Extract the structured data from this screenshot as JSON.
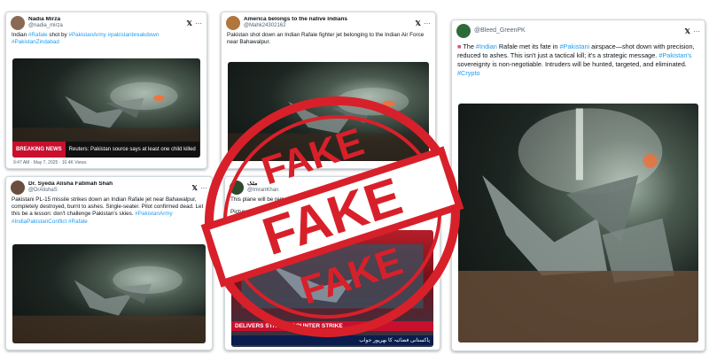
{
  "colors": {
    "accent": "#1d9bf0",
    "stamp": "#d8202a",
    "breaking": "#c8102e",
    "urdu_bar": "#0a1d4d"
  },
  "tweets": [
    {
      "display_name": "Nadia Mirza",
      "handle": "@nadia_mirza",
      "text_prefix": "Indian ",
      "tag1": "#Rafale",
      "text_mid": " shot by ",
      "tag2": "#PakistanArmy #pakistanbreakdown #PakistanZindabad",
      "breaking_label": "BREAKING NEWS",
      "ticker": "Reuters: Pakistan source says at least one child killed",
      "footer": "9:47 AM · May 7, 2025 · 10.4K Views"
    },
    {
      "display_name": "America belongs to the native Indians",
      "handle": "@Mahk24302162",
      "text": "Pakistan shot down an Indian Rafale fighter jet belonging to the Indian Air Force near Bahawalpur."
    },
    {
      "display_name": "Dr. Syeda Alisha Fatimah Shah",
      "handle": "@DrAlishaS",
      "text": "Pakistani PL-15 missile strikes down an Indian Rafale jet near Bahawalpur, completely destroyed, burnt to ashes. Single-seater. Pilot confirmed dead. Let this be a lesson: don't challenge Pakistan's skies.",
      "tags": "#PakistanArmy #IndiaPakistanConflict #Rafale"
    },
    {
      "display_name": "ملک",
      "handle": "@ImranKhan",
      "text_line1": "This plane will be remembered for years",
      "text_line2": "Picture of the Indian Rafale",
      "red_bar": "DELIVERS STRONG COUNTER STRIKE",
      "urdu_text": "پاکستانی فضائیہ کا بھرپور جواب"
    },
    {
      "handle": "@Bleed_GreenPK",
      "text_a": " The ",
      "tag_indian": "#Indian",
      "text_b": " Rafale met its fate in ",
      "tag_pak": "#Pakistani",
      "text_c": " airspace—shot down with precision, reduced to ashes. This isn't just a tactical kill; it's a strategic message. ",
      "tag_pak2": "#Pakistan's",
      "text_d": " sovereignty is non-negotiable. Intruders will be hunted, targeted, and eliminated.",
      "tag_crypto": "#Crypto"
    }
  ],
  "stamp": {
    "top": "FAKE",
    "center": "FAKE",
    "bottom": "FAKE"
  }
}
